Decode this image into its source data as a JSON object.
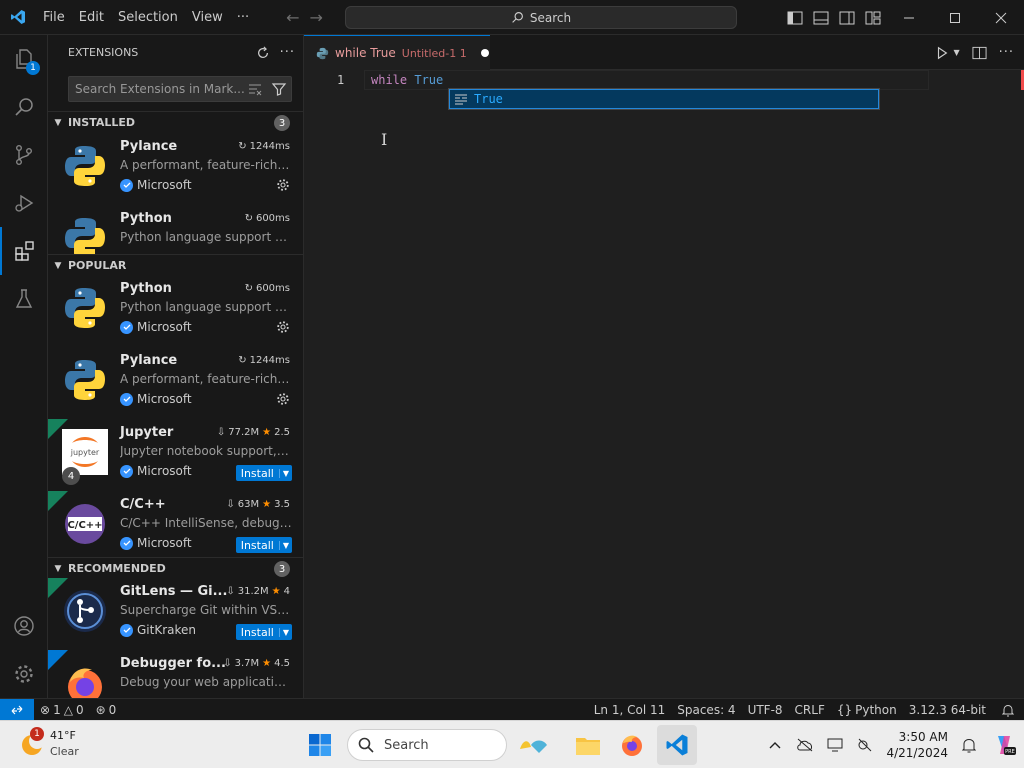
{
  "menu": [
    "File",
    "Edit",
    "Selection",
    "View",
    "···"
  ],
  "command_center": {
    "label": "Search"
  },
  "activity_bar": {
    "explorer_badge": "1"
  },
  "sidebar": {
    "title": "EXTENSIONS",
    "search_placeholder": "Search Extensions in Mark...",
    "sections": {
      "installed": {
        "label": "INSTALLED",
        "count": "3"
      },
      "popular": {
        "label": "POPULAR"
      },
      "recommended": {
        "label": "RECOMMENDED",
        "count": "3"
      }
    },
    "installed": [
      {
        "name": "Pylance",
        "meta": "1244ms",
        "desc": "A performant, feature-rich l...",
        "publisher": "Microsoft"
      },
      {
        "name": "Python",
        "meta": "600ms",
        "desc": "Python language support wi...",
        "publisher": ""
      }
    ],
    "popular": [
      {
        "name": "Python",
        "meta": "600ms",
        "desc": "Python language support wi...",
        "publisher": "Microsoft"
      },
      {
        "name": "Pylance",
        "meta": "1244ms",
        "desc": "A performant, feature-rich l...",
        "publisher": "Microsoft"
      },
      {
        "name": "Jupyter",
        "downloads": "77.2M",
        "rating": "2.5",
        "desc": "Jupyter notebook support, i...",
        "publisher": "Microsoft",
        "install": "Install",
        "badge": "4",
        "icon_text": "jupyter"
      },
      {
        "name": "C/C++",
        "downloads": "63M",
        "rating": "3.5",
        "desc": "C/C++ IntelliSense, debuggi...",
        "publisher": "Microsoft",
        "install": "Install",
        "icon_text": "C/C++"
      }
    ],
    "recommended": [
      {
        "name": "GitLens — Gi...",
        "downloads": "31.2M",
        "rating": "4",
        "desc": "Supercharge Git within VS C...",
        "publisher": "GitKraken",
        "install": "Install"
      },
      {
        "name": "Debugger fo...",
        "downloads": "3.7M",
        "rating": "4.5",
        "desc": "Debug your web application..."
      }
    ]
  },
  "editor": {
    "tab_title": "while True",
    "tab_subtitle": "Untitled-1 1",
    "line_number": "1",
    "code_keyword": "while",
    "code_value": "True",
    "suggestion": "True"
  },
  "status_bar": {
    "errors": "1",
    "warnings": "0",
    "ports": "0",
    "position": "Ln 1, Col 11",
    "spaces": "Spaces: 4",
    "encoding": "UTF-8",
    "eol": "CRLF",
    "language": "Python",
    "interpreter": "3.12.3 64-bit"
  },
  "taskbar": {
    "weather_temp": "41°F",
    "weather_cond": "Clear",
    "weather_badge": "1",
    "search_label": "Search",
    "time": "3:50 AM",
    "date": "4/21/2024"
  },
  "colors": {
    "accent": "#0078d4",
    "editor_bg": "#1f1f1f",
    "chrome_bg": "#181818",
    "modified_tab": "#e89c9c"
  }
}
